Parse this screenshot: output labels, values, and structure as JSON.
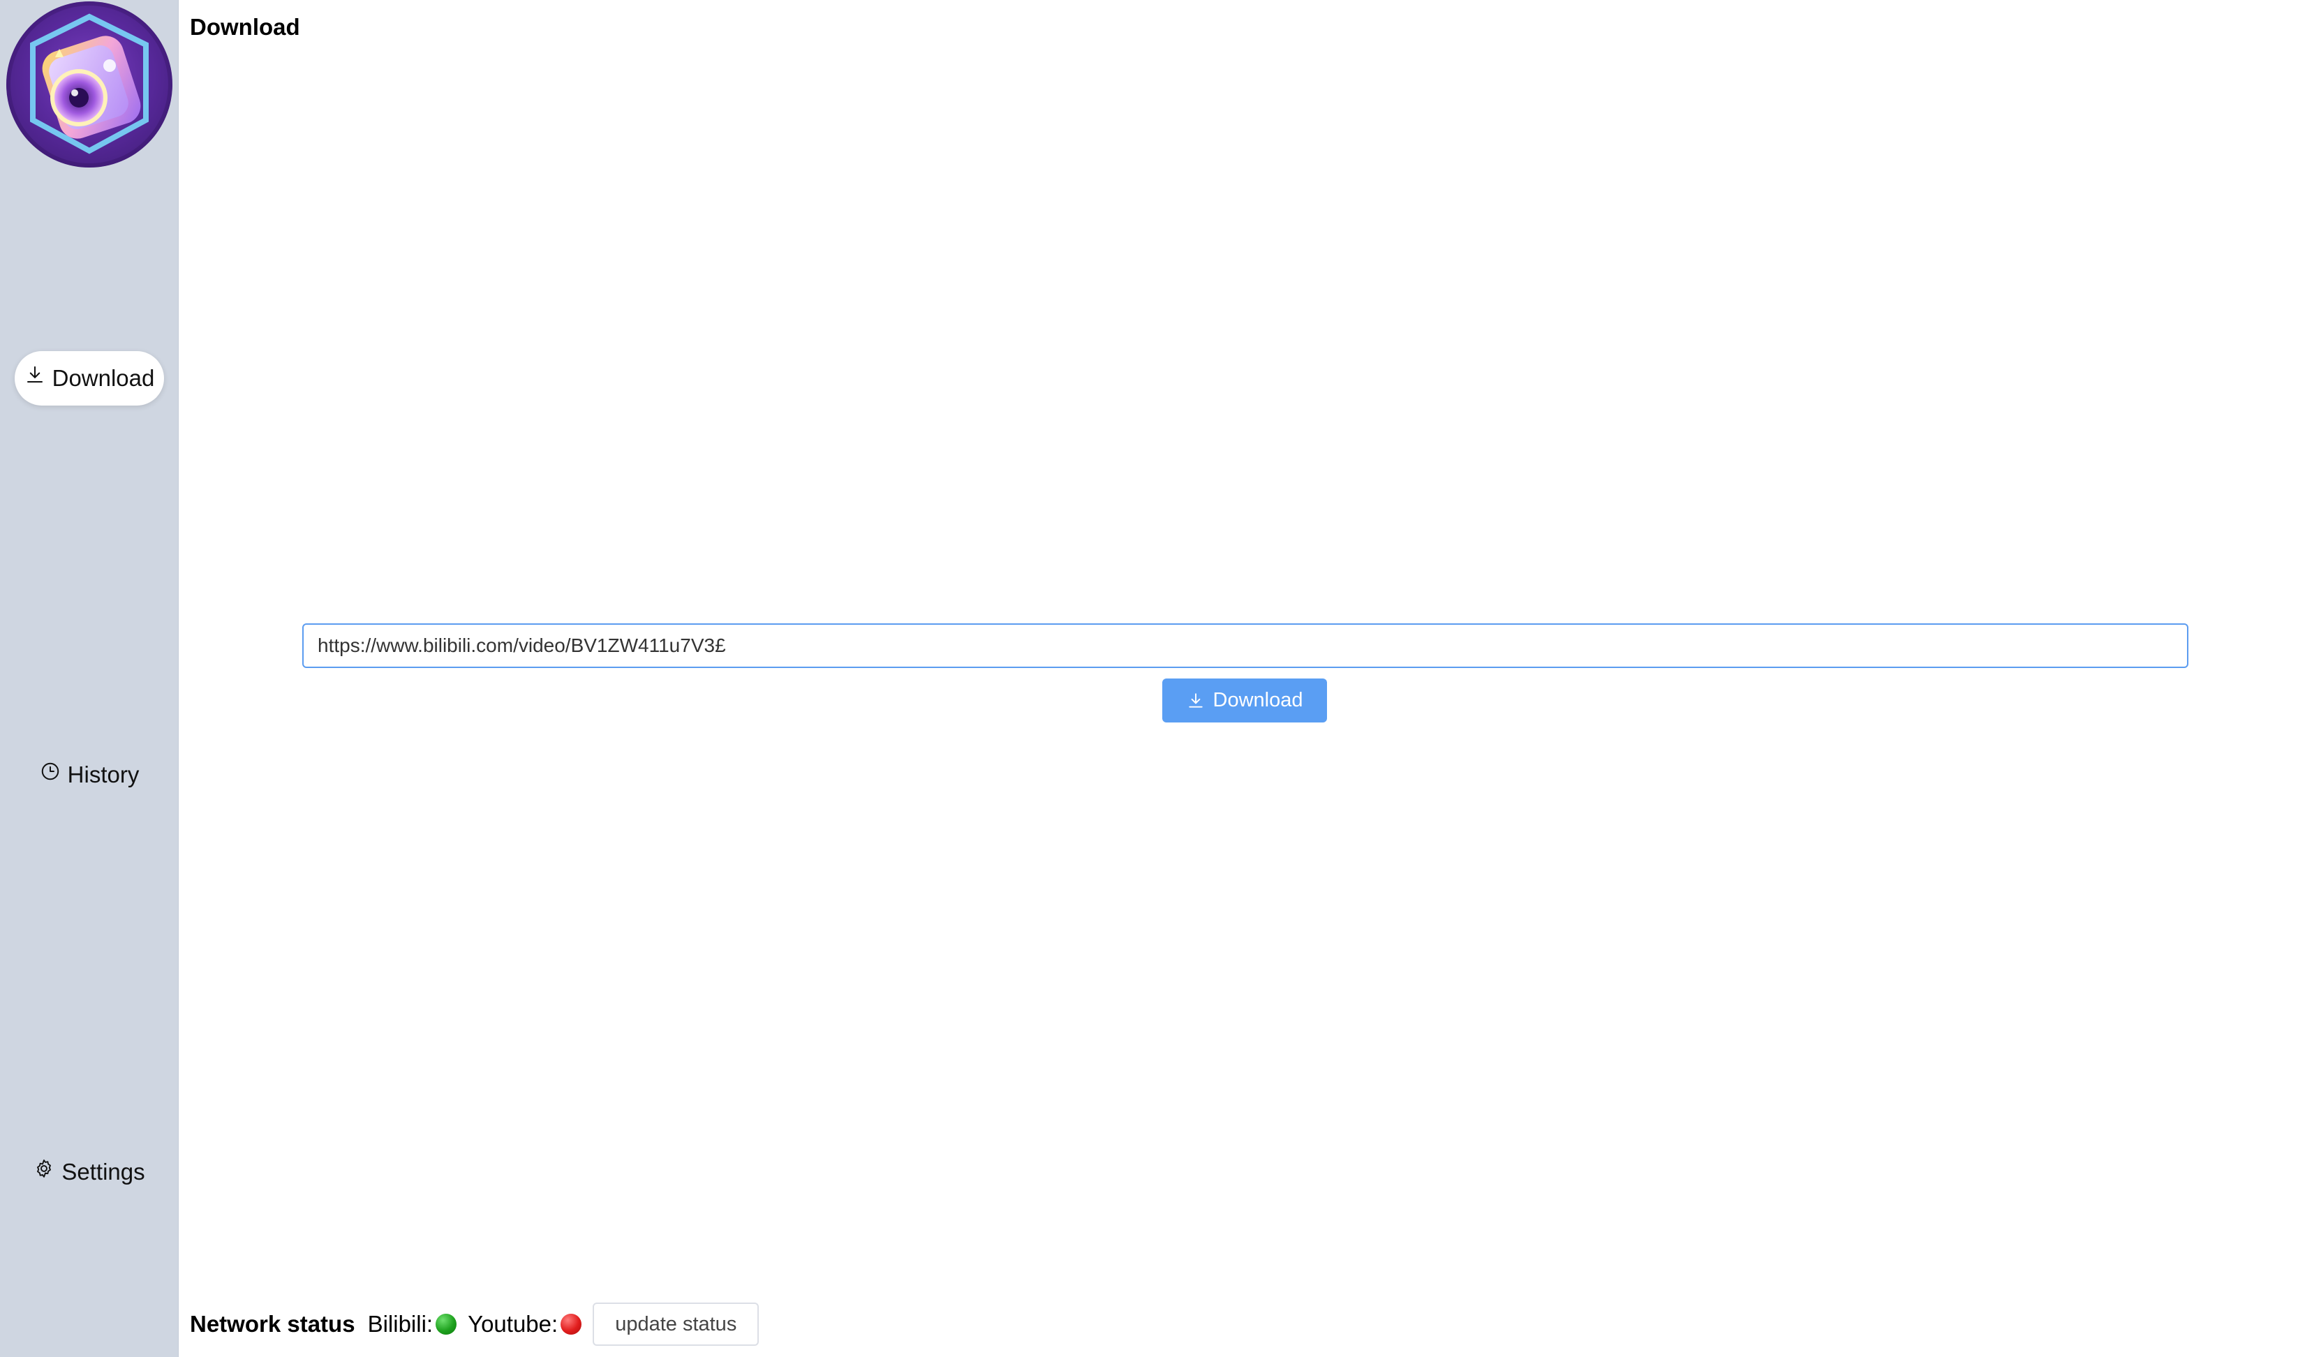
{
  "page": {
    "title": "Download"
  },
  "sidebar": {
    "items": [
      {
        "label": "Download",
        "icon": "download-icon",
        "active": true
      },
      {
        "label": "History",
        "icon": "clock-icon",
        "active": false
      },
      {
        "label": "Settings",
        "icon": "gear-icon",
        "active": false
      }
    ]
  },
  "main": {
    "url_input_value": "https://www.bilibili.com/video/BV1ZW411u7V3£",
    "download_button_label": "Download"
  },
  "footer": {
    "network_status_label": "Network status",
    "bilibili_label": "Bilibili:",
    "bilibili_status": "online",
    "youtube_label": "Youtube:",
    "youtube_status": "offline",
    "update_button_label": "update status"
  },
  "colors": {
    "sidebar_bg": "#cfd6e1",
    "accent": "#5a9ef3",
    "status_online": "#1ea11e",
    "status_offline": "#e11d1d"
  }
}
